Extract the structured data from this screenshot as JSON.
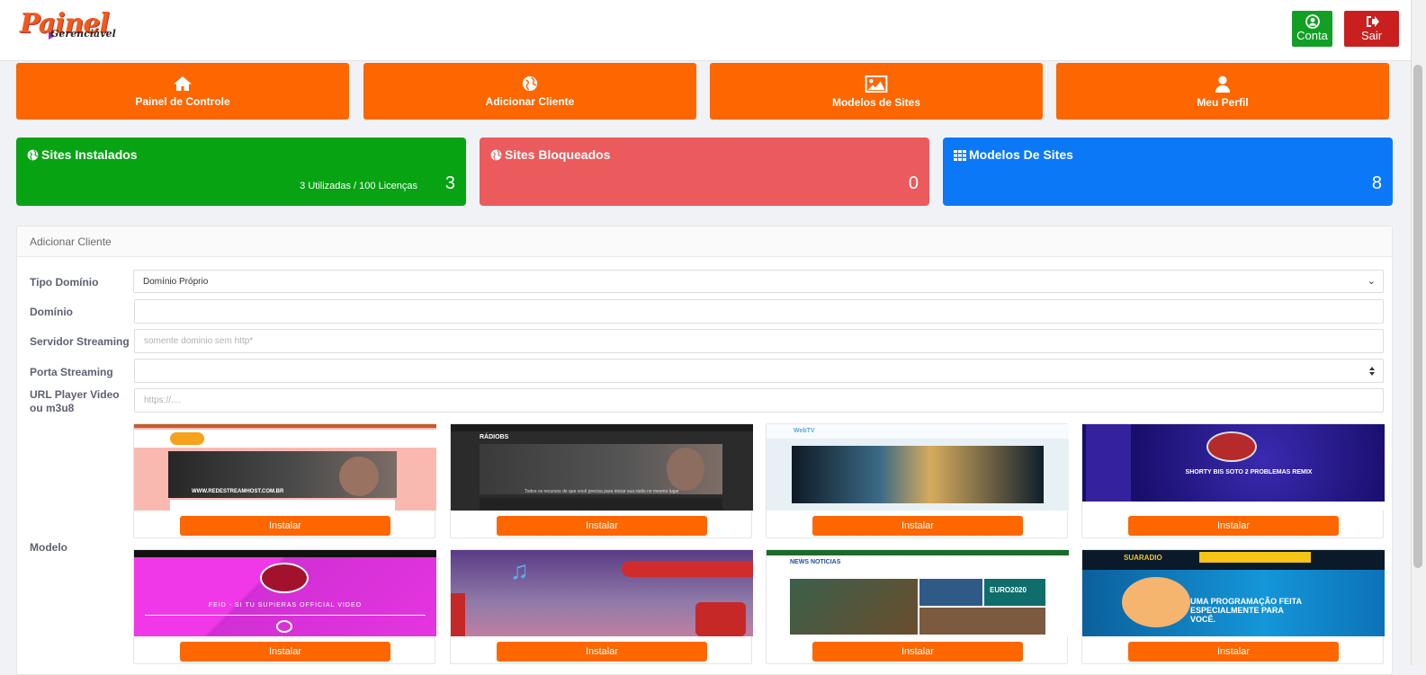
{
  "header": {
    "logo_main": "Painel",
    "logo_sub": "Gerenciável",
    "account_label": "Conta",
    "logout_label": "Sair"
  },
  "nav": [
    {
      "label": "Painel de Controle",
      "icon": "home-icon"
    },
    {
      "label": "Adicionar Cliente",
      "icon": "globe-icon"
    },
    {
      "label": "Modelos de Sites",
      "icon": "image-icon"
    },
    {
      "label": "Meu Perfil",
      "icon": "user-icon"
    }
  ],
  "stats": [
    {
      "title": "Sites Instalados",
      "value": "3",
      "subtitle": "3 Utilizadas / 100 Licenças",
      "color": "#07a313",
      "icon": "globe-icon"
    },
    {
      "title": "Sites Bloqueados",
      "value": "0",
      "subtitle": "",
      "color": "#eb5a5c",
      "icon": "globe-icon"
    },
    {
      "title": "Modelos De Sites",
      "value": "8",
      "subtitle": "",
      "color": "#0b79f7",
      "icon": "grid-icon"
    }
  ],
  "form": {
    "panel_title": "Adicionar Cliente",
    "tipo_label": "Tipo Domínio",
    "tipo_value": "Domínio Próprio",
    "dominio_label": "Domínio",
    "dominio_value": "",
    "servidor_label": "Servidor Streaming",
    "servidor_placeholder": "somente dominio sem http*",
    "porta_label": "Porta Streaming",
    "porta_value": "",
    "url_label": "URL Player Video ou m3u8",
    "url_placeholder": "https://....",
    "modelo_label": "Modelo"
  },
  "models": [
    {
      "install_label": "Instalar",
      "theme": "pink-radio",
      "banner_text": "WWW.REDESTREAMHOST.COM.BR"
    },
    {
      "install_label": "Instalar",
      "theme": "dark-radio",
      "brand_text": "RÁDIOBS",
      "caption_text": "Todos os recursos de que você precisa para iniciar sua rádio no mesmo lugar"
    },
    {
      "install_label": "Instalar",
      "theme": "webtv",
      "brand_text": "WebTV"
    },
    {
      "install_label": "Instalar",
      "theme": "purple-space",
      "caption_text": "SHORTY BIS SOTO 2 PROBLEMAS REMIX"
    },
    {
      "install_label": "Instalar",
      "theme": "magenta",
      "caption_text": "FEID - SI TU SUPIERAS OFFICIAL VIDEO"
    },
    {
      "install_label": "Instalar",
      "theme": "violet-music"
    },
    {
      "install_label": "Instalar",
      "theme": "news",
      "brand_text": "NEWS NOTICIAS",
      "caption_text": "EURO2020"
    },
    {
      "install_label": "Instalar",
      "theme": "blue-radio",
      "brand_text": "SUARADIO",
      "caption_text": "UMA PROGRAMAÇÃO FEITA ESPECIALMENTE PARA VOCÊ."
    }
  ],
  "colors": {
    "accent": "#fe6600",
    "bg": "#f0f2f5"
  }
}
